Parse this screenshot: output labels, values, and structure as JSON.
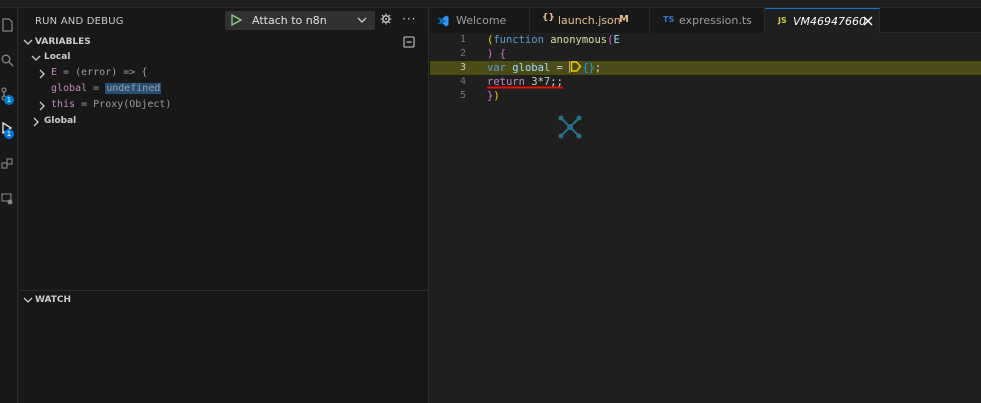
{
  "sidebar": {
    "title": "RUN AND DEBUG",
    "config_label": "Attach to n8n",
    "variables": {
      "title": "VARIABLES",
      "local_label": "Local",
      "rows": [
        {
          "name": "E",
          "eq": " = ",
          "value": "(error) => {"
        },
        {
          "name": "global",
          "eq": " = ",
          "value": "undefined"
        },
        {
          "name": "this",
          "eq": " = ",
          "value": "Proxy(Object)"
        }
      ],
      "global_label": "Global"
    },
    "watch_title": "WATCH"
  },
  "activity": {
    "badges": [
      "1",
      "1"
    ]
  },
  "tabs": [
    {
      "icon": "vscode-icon",
      "label": "Welcome"
    },
    {
      "icon": "{}",
      "label": "launch.json",
      "modified": "M"
    },
    {
      "icon": "TS",
      "label": "expression.ts"
    },
    {
      "icon": "JS",
      "label": "VM46947660"
    }
  ],
  "editor": {
    "line_numbers": [
      "1",
      "2",
      "3",
      "4",
      "5"
    ],
    "lines": {
      "l1": {
        "p1": "(",
        "p2": "function",
        "p3": " ",
        "p4": "anonymous",
        "p5": "(",
        "p6": "E"
      },
      "l2": {
        "p1": ")",
        "p2": " ",
        "p3": "{"
      },
      "l3": {
        "p1": "var",
        "p2": " ",
        "p3": "global",
        "p4": " = ",
        "p5": "{",
        "p6": "}",
        "p7": ";"
      },
      "l4": {
        "p1": "return",
        "p2": " ",
        "p3": "3",
        "p4": "*",
        "p5": "7",
        "p6": ";;"
      },
      "l5": {
        "p1": "}",
        "p2": ")"
      }
    }
  },
  "colors": {
    "accent": "#0078d4",
    "breakpoint": "#ffcc00",
    "current_line": "#4b4b18",
    "squiggle": "#e51400"
  }
}
